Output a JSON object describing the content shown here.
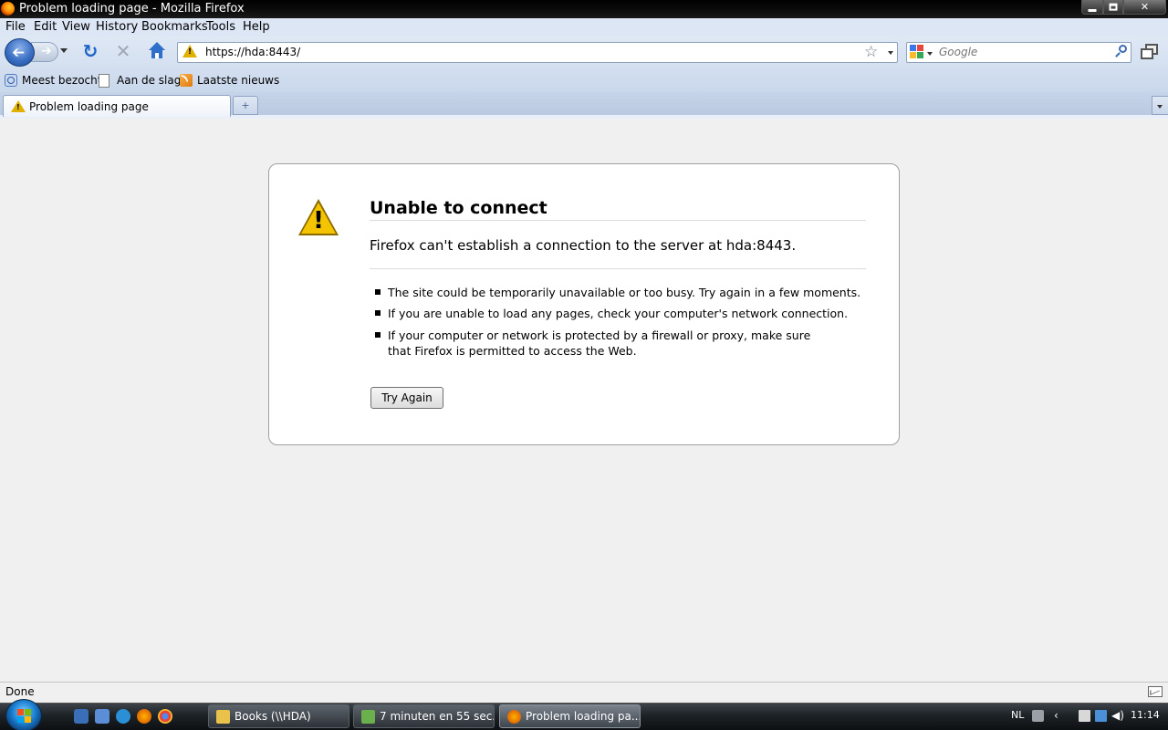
{
  "window": {
    "title": "Problem loading page - Mozilla Firefox"
  },
  "menubar": {
    "items": [
      "File",
      "Edit",
      "View",
      "History",
      "Bookmarks",
      "Tools",
      "Help"
    ]
  },
  "navbar": {
    "url": "https://hda:8443/",
    "search_placeholder": "Google"
  },
  "bookmarks": {
    "items": [
      "Meest bezocht",
      "Aan de slag",
      "Laatste nieuws"
    ]
  },
  "tabs": {
    "active_label": "Problem loading page"
  },
  "error": {
    "title": "Unable to connect",
    "short_desc": "Firefox can't establish a connection to the server at hda:8443.",
    "bullets": [
      "The site could be temporarily unavailable or too busy. Try again in a few moments.",
      "If you are unable to load any pages, check your computer's network connection.",
      "If your computer or network is protected by a firewall or proxy, make sure that Firefox is permitted to access the Web."
    ],
    "button_label": "Try Again"
  },
  "statusbar": {
    "text": "Done"
  },
  "taskbar": {
    "buttons": [
      "Books (\\\\HDA)",
      "7 minuten en 55 sec...",
      "Problem loading pa..."
    ],
    "language": "NL",
    "clock": "11:14"
  },
  "colors": {
    "warning": "#f5c400",
    "accent": "#1f65c7"
  }
}
